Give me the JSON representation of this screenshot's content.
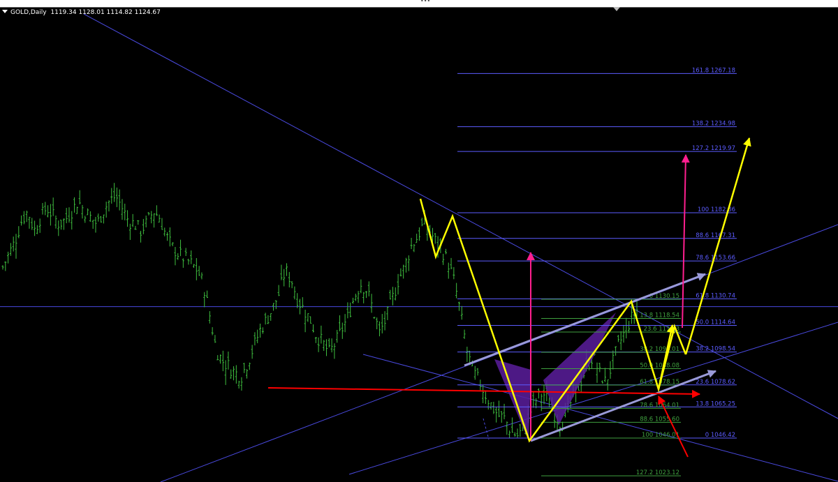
{
  "header": {
    "symbol": "GOLD,Daily",
    "ohlc": "1119.34 1128.01 1114.82 1124.67"
  },
  "colors": {
    "background": "#000000",
    "candles": "#3fbf3f",
    "trendlines": "#4a4ae0",
    "fib_upper": "#5c5cff",
    "fib_lower": "#3fa03f",
    "zigzag": "#ffff00",
    "target_arrows": "#ff1f8f",
    "support_line": "#ff0000",
    "channel": "#9a9ad8",
    "pattern_fill": "#5a1d9c"
  },
  "chart_data": {
    "type": "candlestick",
    "title": "GOLD,Daily",
    "ohlc_last": {
      "open": 1119.34,
      "high": 1128.01,
      "low": 1114.82,
      "close": 1124.67
    },
    "close_path": [
      1150,
      1158,
      1166,
      1178,
      1184,
      1172,
      1180,
      1186,
      1181,
      1176,
      1179,
      1184,
      1190,
      1184,
      1180,
      1176,
      1184,
      1190,
      1193,
      1186,
      1178,
      1176,
      1172,
      1177,
      1184,
      1180,
      1169,
      1162,
      1158,
      1155,
      1152,
      1148,
      1139,
      1120,
      1100,
      1093,
      1090,
      1086,
      1084,
      1092,
      1102,
      1112,
      1118,
      1125,
      1134,
      1148,
      1142,
      1130,
      1124,
      1118,
      1108,
      1104,
      1098,
      1104,
      1112,
      1120,
      1132,
      1140,
      1136,
      1124,
      1110,
      1118,
      1130,
      1142,
      1150,
      1162,
      1168,
      1176,
      1172,
      1165,
      1160,
      1152,
      1140,
      1120,
      1098,
      1086,
      1080,
      1072,
      1065,
      1060,
      1058,
      1050,
      1048,
      1052,
      1062,
      1070,
      1074,
      1068,
      1060,
      1055,
      1064,
      1072,
      1080,
      1090,
      1096,
      1086,
      1080,
      1090,
      1102,
      1110,
      1118,
      1124
    ],
    "fib_upper_levels": [
      {
        "label": "161.8 1267.18",
        "price": 1267.18
      },
      {
        "label": "138.2 1234.98",
        "price": 1234.98
      },
      {
        "label": "127.2 1219.97",
        "price": 1219.97
      },
      {
        "label": "100 1182.86",
        "price": 1182.86
      },
      {
        "label": "88.6 1167.31",
        "price": 1167.31
      },
      {
        "label": "78.6 1153.66",
        "price": 1153.66
      },
      {
        "label": "61.8 1130.74",
        "price": 1130.74
      },
      {
        "label": "50.0 1114.64",
        "price": 1114.64
      },
      {
        "label": "38.2 1098.54",
        "price": 1098.54
      },
      {
        "label": "23.6 1078.62",
        "price": 1078.62
      },
      {
        "label": "13.8 1065.25",
        "price": 1065.25
      },
      {
        "label": "0 1046.42",
        "price": 1046.42
      }
    ],
    "fib_lower_levels": [
      {
        "label": "0 1130.15",
        "price": 1130.15
      },
      {
        "label": "13.8 1118.54",
        "price": 1118.54
      },
      {
        "label": "23.6 1110.3",
        "price": 1110.3
      },
      {
        "label": "38.2 1098.01",
        "price": 1098.01
      },
      {
        "label": "50.0 1088.08",
        "price": 1088.08
      },
      {
        "label": "61.8 1078.15",
        "price": 1078.15
      },
      {
        "label": "78.6 1064.01",
        "price": 1064.01
      },
      {
        "label": "88.6 1055.60",
        "price": 1055.6
      },
      {
        "label": "100 1046.01",
        "price": 1046.01
      },
      {
        "label": "127.2 1023.12",
        "price": 1023.12
      }
    ],
    "zigzag_prices": [
      1185,
      1158,
      1180,
      1046,
      1131,
      1078,
      1112,
      1099,
      1224
    ],
    "target_arrows": [
      {
        "from": 1046,
        "to": 1158
      },
      {
        "from": 1110,
        "to": 1212
      }
    ],
    "support_price": 1085,
    "horizontal_line_price": 1126
  }
}
